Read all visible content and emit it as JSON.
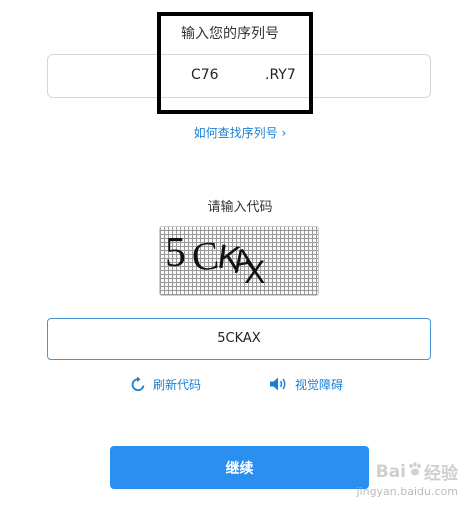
{
  "serial": {
    "title": "输入您的序列号",
    "part1": "C76",
    "part2": ".RY7",
    "find_link": "如何查找序列号"
  },
  "captcha": {
    "title": "请输入代码",
    "image_text": "5CKAX",
    "input_value": "5CKAX",
    "refresh_label": "刷新代码",
    "audio_label": "视觉障碍"
  },
  "actions": {
    "continue_label": "继续"
  },
  "watermark": {
    "brand_left": "Bai",
    "brand_right": "经验",
    "url": "jingyan.baidu.com"
  },
  "colors": {
    "accent": "#2b8fef",
    "link": "#1a7fd4",
    "input_focus_border": "#4a95d6"
  }
}
